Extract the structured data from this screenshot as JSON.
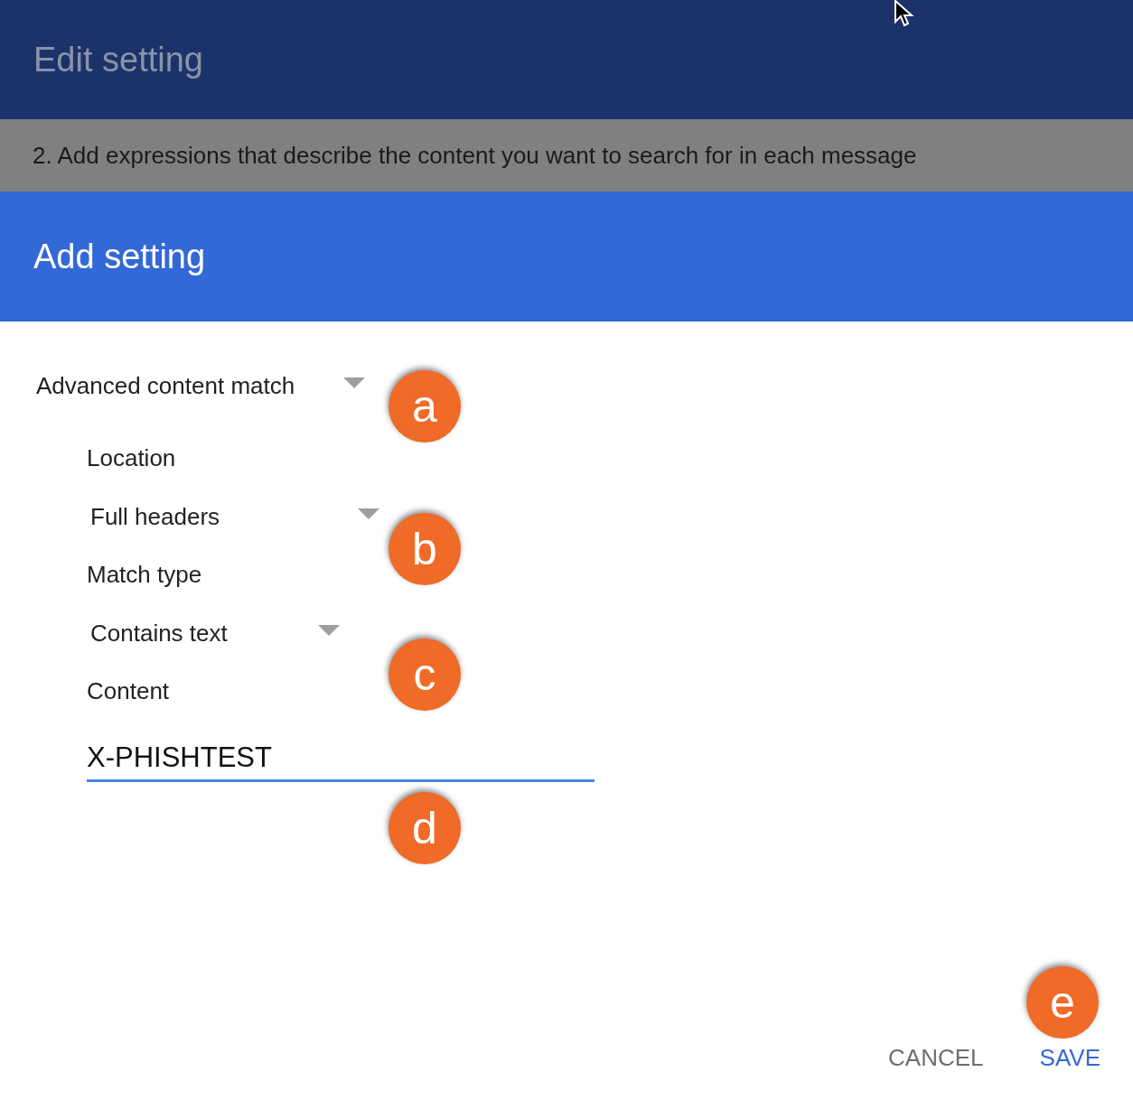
{
  "header": {
    "title": "Edit setting"
  },
  "step": {
    "text": "2. Add expressions that describe the content you want to search for in each message"
  },
  "dialog": {
    "title": "Add setting",
    "type_select": {
      "value": "Advanced content match"
    },
    "fields": [
      {
        "kind": "select",
        "label": "Location",
        "value": "Full headers"
      },
      {
        "kind": "select",
        "label": "Match type",
        "value": "Contains text"
      },
      {
        "kind": "input",
        "label": "Content",
        "value": "X-PHISHTEST",
        "focused": true
      }
    ],
    "buttons": [
      {
        "label": "CANCEL",
        "kind": "secondary"
      },
      {
        "label": "SAVE",
        "kind": "primary"
      }
    ]
  },
  "callouts": [
    "a",
    "b",
    "c",
    "d",
    "e"
  ]
}
